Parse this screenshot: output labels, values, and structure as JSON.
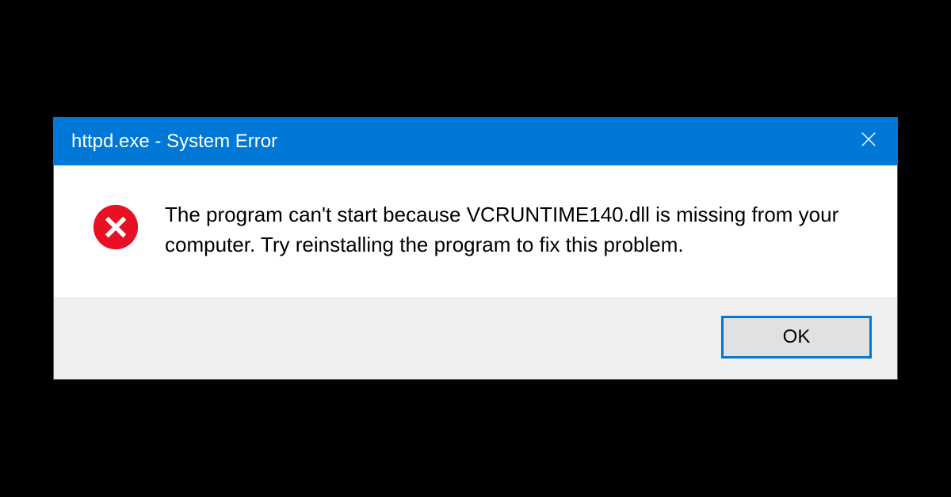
{
  "dialog": {
    "title": "httpd.exe - System Error",
    "message": "The program can't start because VCRUNTIME140.dll is missing from your computer. Try reinstalling the program to fix this problem.",
    "ok_label": "OK"
  },
  "colors": {
    "accent": "#0078d7",
    "error_icon": "#e81123"
  }
}
